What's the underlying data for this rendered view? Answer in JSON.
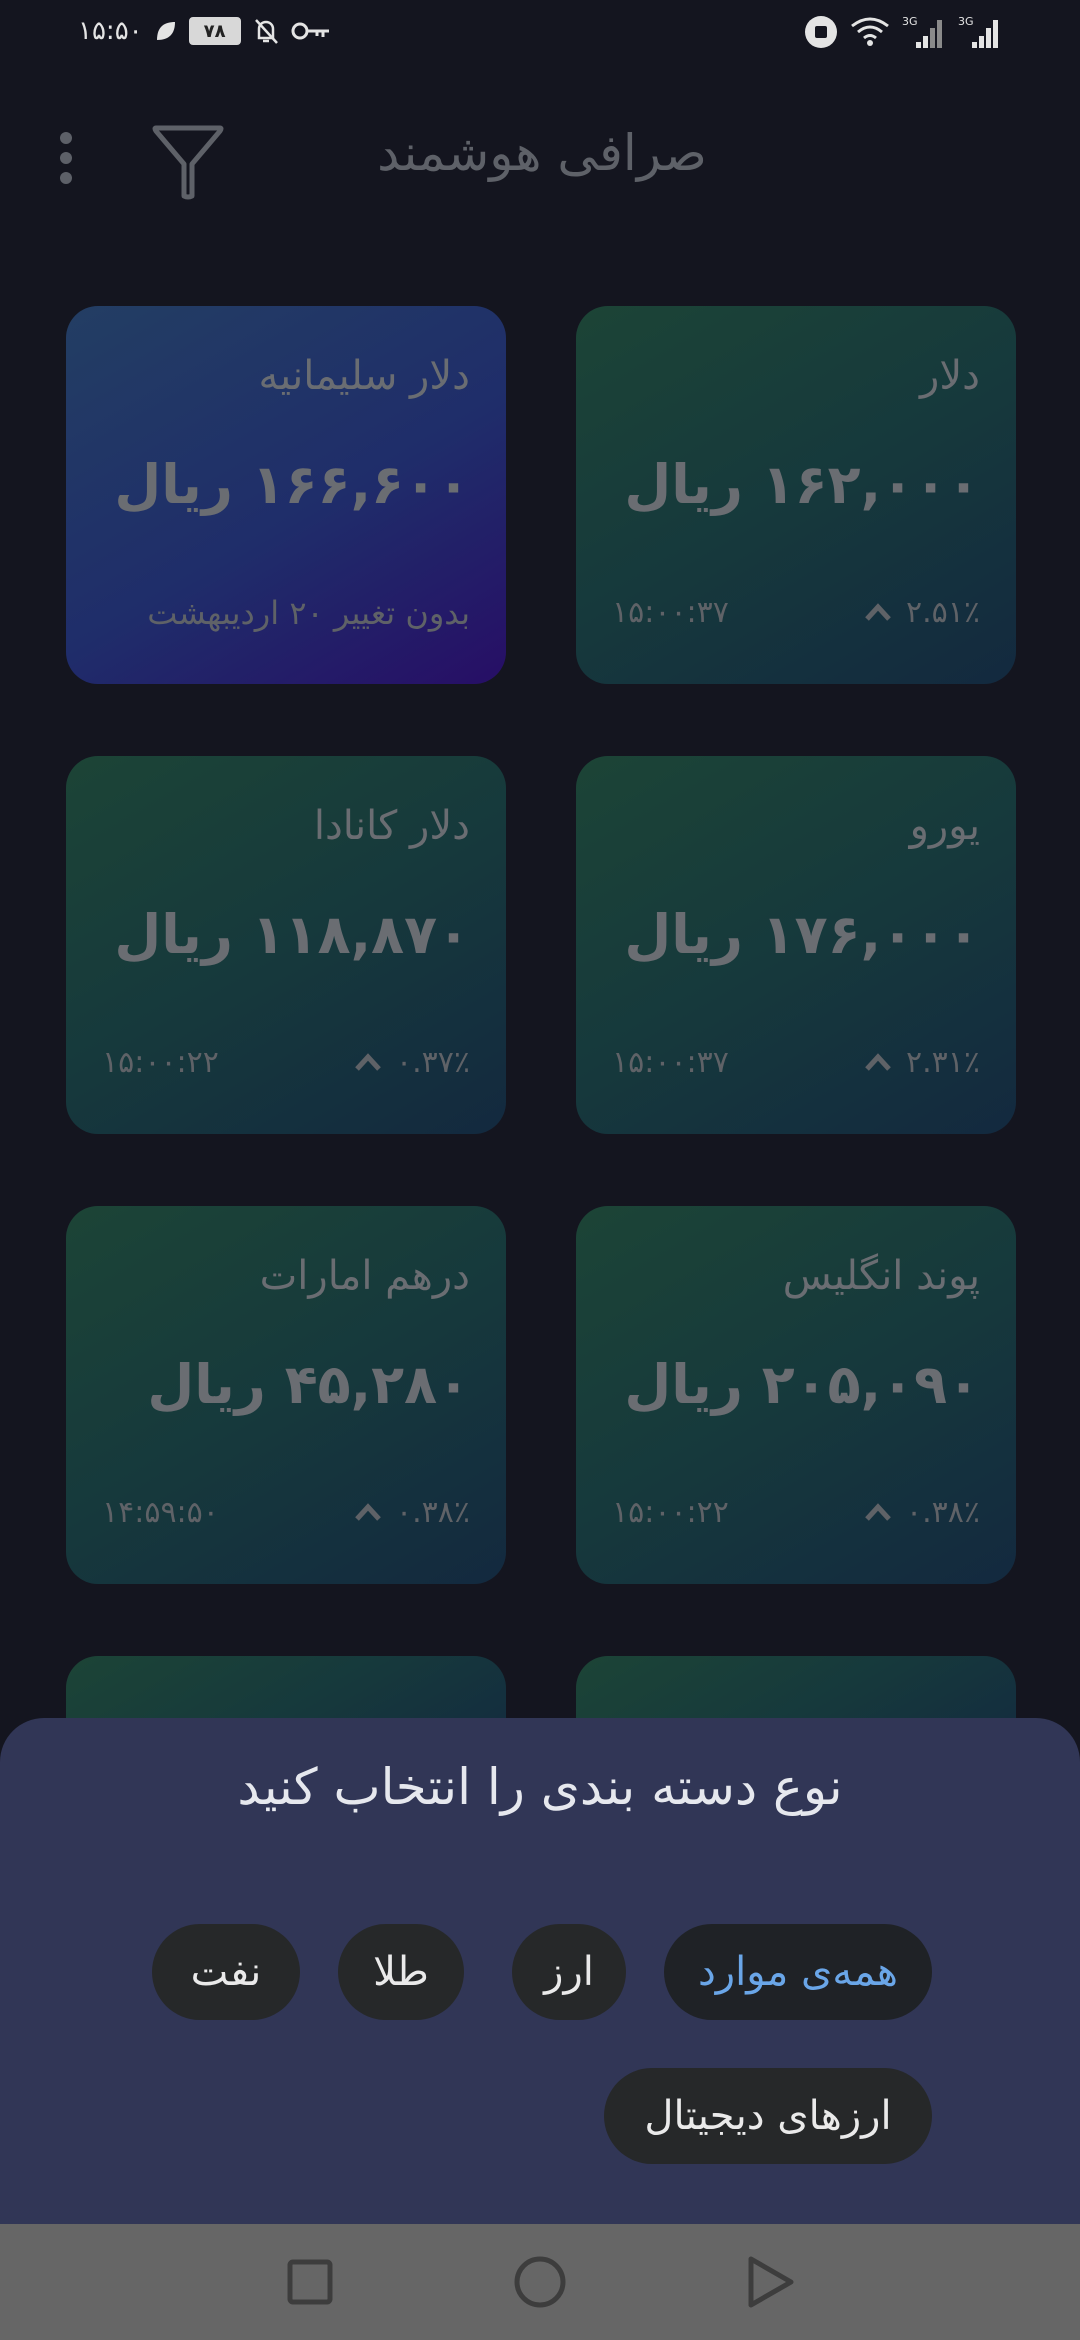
{
  "status_bar": {
    "time": "۱۵:۵۰",
    "battery_level": "۷۸",
    "network_1": "3G",
    "network_2": "3G"
  },
  "app_bar": {
    "title": "صرافی هوشمند",
    "filter_icon": "filter-icon",
    "menu_icon": "more-vert-icon"
  },
  "cards": [
    {
      "name": "دلار",
      "price": "۱۶۲,۰۰۰ ریال",
      "change": "۲.۵۱٪",
      "time": "۱۵:۰۰:۳۷",
      "trend": "up"
    },
    {
      "name": "دلار سلیمانیه",
      "price": "۱۶۶,۶۰۰ ریال",
      "note": "بدون تغییر ۲۰ اردیبهشت",
      "accent": "#241a66"
    },
    {
      "name": "یورو",
      "price": "۱۷۶,۰۰۰ ریال",
      "change": "۲.۳۱٪",
      "time": "۱۵:۰۰:۳۷",
      "trend": "up"
    },
    {
      "name": "دلار کانادا",
      "price": "۱۱۸,۸۷۰ ریال",
      "change": "۰.۳۷٪",
      "time": "۱۵:۰۰:۲۲",
      "trend": "up"
    },
    {
      "name": "پوند انگلیس",
      "price": "۲۰۵,۰۹۰ ریال",
      "change": "۰.۳۸٪",
      "time": "۱۵:۰۰:۲۲",
      "trend": "up"
    },
    {
      "name": "درهم امارات",
      "price": "۴۵,۲۸۰ ریال",
      "change": "۰.۳۸٪",
      "time": "۱۴:۵۹:۵۰",
      "trend": "up"
    }
  ],
  "sheet": {
    "title": "نوع دسته بندی را انتخاب کنید",
    "chips": [
      {
        "label": "همه‌ی موارد",
        "selected": true
      },
      {
        "label": "ارز",
        "selected": false
      },
      {
        "label": "طلا",
        "selected": false
      },
      {
        "label": "نفت",
        "selected": false
      },
      {
        "label": "ارزهای دیجیتال",
        "selected": false
      }
    ]
  },
  "nav_bar": {
    "recents": "square-icon",
    "home": "circle-icon",
    "back": "triangle-icon"
  },
  "colors": {
    "background": "#14151f",
    "card_green": "#1c4436",
    "card_purple": "#1f2d6a",
    "sheet": "#313656",
    "chip_selected_text": "#6aa6e8"
  }
}
